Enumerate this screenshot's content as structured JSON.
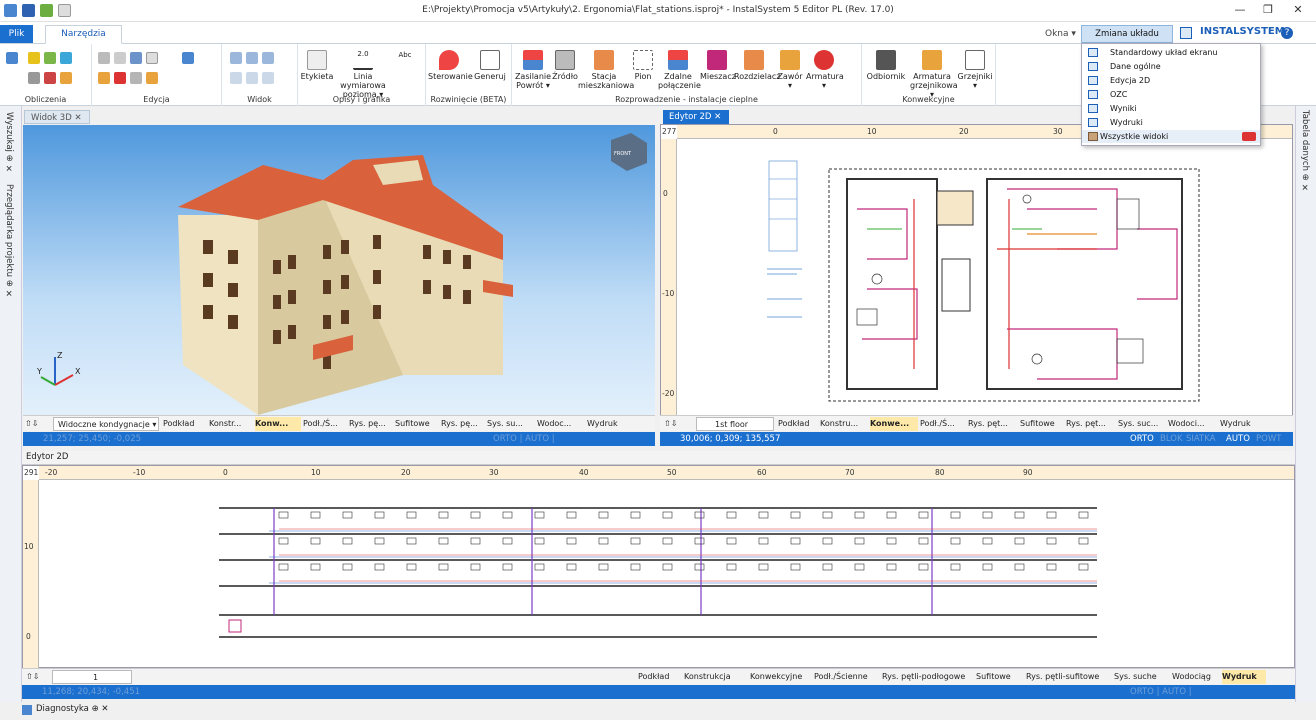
{
  "window": {
    "title": "E:\\Projekty\\Promocja v5\\Artykuły\\2. Ergonomia\\Flat_stations.isproj* - InstalSystem 5 Editor PL (Rev. 17.0)",
    "minimize": "—",
    "restore": "❐",
    "close": "✕"
  },
  "tabs": {
    "file": "Plik",
    "home": "Narzędzia główne"
  },
  "top_right": {
    "windows": "Okna ▾",
    "layout": "Zmiana układu ekranu ▾",
    "logo": "INSTALSYSTEM",
    "help": "?"
  },
  "ribbon": {
    "groups": [
      "Obliczenia",
      "Edycja",
      "Widok",
      "Opisy i grafika",
      "Rozwinięcie (BETA)",
      "Rozprowadzenie - instalacje cieplne",
      "Konwekcyjne"
    ],
    "buttons": {
      "label": "Etykieta",
      "dim": "Linia wymiarowa pozioma ▾",
      "steer": "Sterowanie",
      "gen": "Generuj",
      "supply": "Zasilanie Powrót ▾",
      "source": "Źródło",
      "station": "Stacja mieszkaniowa",
      "pion": "Pion",
      "remote": "Zdalne połączenie",
      "mixer": "Mieszacz",
      "distributor": "Rozdzielacz",
      "valve": "Zawór ▾",
      "fitting": "Armatura ▾",
      "receiver": "Odbiornik",
      "rad_fitting": "Armatura grzejnikowa ▾",
      "radiators": "Grzejniki ▾",
      "dim_label": "2.0",
      "abc": "Abc"
    }
  },
  "left_sidebar": {
    "tabs": [
      "Wyszukaj ⊕ ✕",
      "Przeglądarka projektu ⊕ ✕"
    ]
  },
  "right_sidebar": {
    "tabs": [
      "Tabela danych ⊕ ✕"
    ]
  },
  "view3d": {
    "tab": "Widok 3D ✕",
    "axes": {
      "z": "Z",
      "x": "X",
      "y": "Y"
    },
    "cube": "FRONT",
    "status_left": "21,257; 25,450; -0,025",
    "status_right": "ORTO | AUTO |"
  },
  "view3d_tabs": [
    "Widoczne kondygnacje ▾",
    "Podkład",
    "Konstr...",
    "Konw...",
    "Podł./Ś...",
    "Rys. pę...",
    "Sufitowe",
    "Rys. pę...",
    "Sys. su...",
    "Wodoc...",
    "Wydruk"
  ],
  "editor2d_top": {
    "tab": "Edytor 2D ✕",
    "ruler_x": [
      "0",
      "10",
      "20",
      "30"
    ],
    "ruler_y": [
      "0",
      "-10",
      "-20"
    ],
    "corner": "277",
    "floor": "1st floor",
    "coords": "30,006; 0,309; 135,557",
    "status": [
      "ORTO",
      "BLOK",
      "SIATKA",
      "AUTO",
      "POWT"
    ]
  },
  "editor2d_top_tabs": [
    "Podkład",
    "Konstru...",
    "Konwe...",
    "Podł./Ś...",
    "Rys. pęt...",
    "Sufitowe",
    "Rys. pęt...",
    "Sys. suc...",
    "Wodoci...",
    "Wydruk"
  ],
  "editor2d_bottom": {
    "tab": "Edytor 2D",
    "ruler_x": [
      "-20",
      "-10",
      "0",
      "10",
      "20",
      "30",
      "40",
      "50",
      "60",
      "70",
      "80",
      "90"
    ],
    "ruler_y": [
      "10",
      "0"
    ],
    "corner": "291",
    "level": "1",
    "coords": "11,268; 20,434; -0,451",
    "status": "ORTO | AUTO |"
  },
  "editor2d_bottom_tabs": [
    "Podkład",
    "Konstrukcja",
    "Konwekcyjne",
    "Podł./Ścienne",
    "Rys. pętli-podłogowe",
    "Sufitowe",
    "Rys. pętli-sufitowe",
    "Sys. suche",
    "Wodociąg",
    "Wydruk"
  ],
  "diagnostics": {
    "tab": "Diagnostyka ⊕ ✕"
  },
  "layout_menu": [
    "Standardowy układ ekranu",
    "Dane ogólne",
    "Edycja 2D",
    "OZC",
    "Wyniki",
    "Wydruki",
    "Wszystkie widoki"
  ],
  "colors": {
    "accent": "#1b6fcf",
    "roof": "#d9613b",
    "wall": "#efe3c2"
  }
}
